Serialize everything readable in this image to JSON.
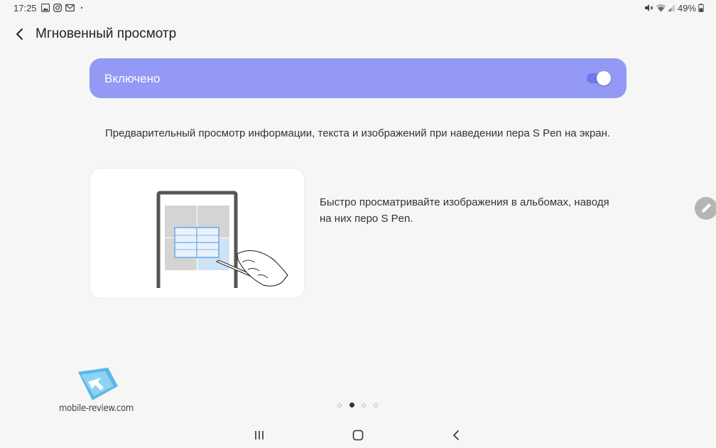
{
  "status_bar": {
    "time": "17:25",
    "notification_icons": [
      "gallery-icon",
      "instagram-icon",
      "mail-icon",
      "dot-icon"
    ],
    "status_icons": [
      "mute-icon",
      "wifi-icon",
      "signal-icon",
      "battery-icon"
    ],
    "battery": "49%"
  },
  "app_bar": {
    "title": "Мгновенный просмотр"
  },
  "toggle": {
    "label": "Включено",
    "enabled": true,
    "accent_color": "#9399f4"
  },
  "description": "Предварительный просмотр информации, текста и изображений при наведении пера S Pen на экран.",
  "pages": [
    {
      "illustration": "tablet-gallery-preview-illustration",
      "caption": "Быстро просматривайте изображения в альбомах, наводя на них перо S Pen."
    }
  ],
  "pager": {
    "count": 4,
    "active_index": 1
  },
  "watermark": {
    "text": "mobile-review.com"
  },
  "nav_bar": {
    "buttons": [
      "recents-icon",
      "home-icon",
      "back-icon"
    ]
  }
}
